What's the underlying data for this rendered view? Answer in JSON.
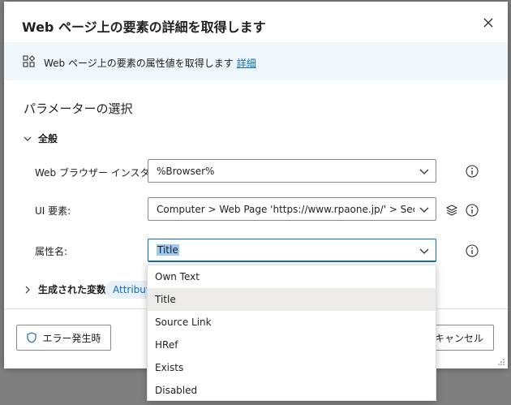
{
  "dialog": {
    "title": "Web ページ上の要素の詳細を取得します",
    "info_text": "Web ページ上の要素の属性値を取得します",
    "info_link": "詳細",
    "section_title": "パラメーターの選択",
    "group_general": "全般",
    "fields": {
      "browser_label": "Web ブラウザー インスタンス:",
      "browser_value": "%Browser%",
      "ui_label": "UI 要素:",
      "ui_value": "Computer > Web Page 'https://www.rpaone.jp/' > Section '",
      "attr_label": "属性名:",
      "attr_value": "Title"
    },
    "generated_vars_label": "生成された変数",
    "generated_var_chip": "Attribute",
    "error_button": "エラー発生時",
    "cancel_button": "キャンセル"
  },
  "dropdown": {
    "options": [
      "Own Text",
      "Title",
      "Source Link",
      "HRef",
      "Exists",
      "Disabled"
    ],
    "selected": "Title"
  },
  "colors": {
    "accent": "#0f6cbd",
    "info_bar": "#eff6fc",
    "selected_option": "#edebe9"
  }
}
